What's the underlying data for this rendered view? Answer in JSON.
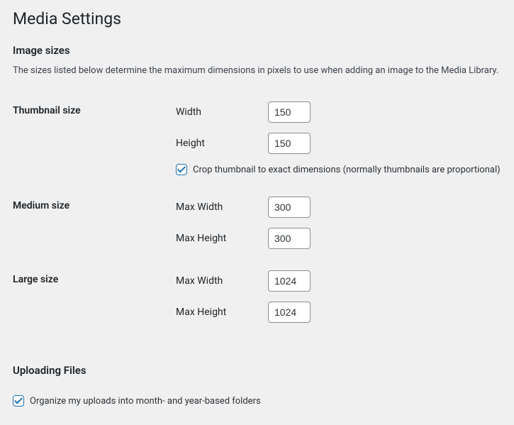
{
  "page": {
    "title": "Media Settings"
  },
  "sections": {
    "image_sizes": {
      "heading": "Image sizes",
      "description": "The sizes listed below determine the maximum dimensions in pixels to use when adding an image to the Media Library."
    },
    "uploading": {
      "heading": "Uploading Files"
    }
  },
  "thumbnail": {
    "label": "Thumbnail size",
    "width_label": "Width",
    "width_value": "150",
    "height_label": "Height",
    "height_value": "150",
    "crop_label": "Crop thumbnail to exact dimensions (normally thumbnails are proportional)",
    "crop_checked": true
  },
  "medium": {
    "label": "Medium size",
    "max_width_label": "Max Width",
    "max_width_value": "300",
    "max_height_label": "Max Height",
    "max_height_value": "300"
  },
  "large": {
    "label": "Large size",
    "max_width_label": "Max Width",
    "max_width_value": "1024",
    "max_height_label": "Max Height",
    "max_height_value": "1024"
  },
  "uploads": {
    "organize_label": "Organize my uploads into month- and year-based folders",
    "organize_checked": true
  }
}
